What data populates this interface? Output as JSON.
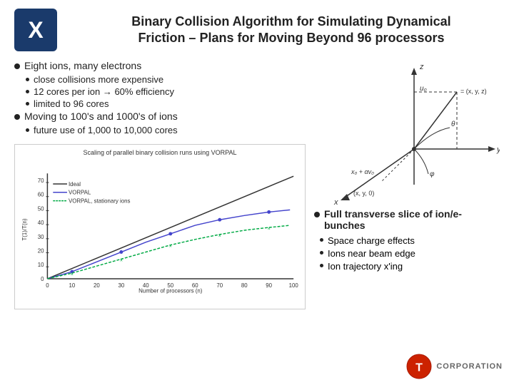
{
  "header": {
    "title_line1": "Binary Collision Algorithm for Simulating Dynamical",
    "title_line2": "Friction – Plans for Moving Beyond 96 processors"
  },
  "left_bullets": {
    "main1": {
      "label": "Eight ions, many electrons",
      "subs": [
        {
          "text": "close collisions more expensive"
        },
        {
          "text": "12 cores per ion → 60% efficiency"
        },
        {
          "text": "limited to 96 cores"
        }
      ]
    },
    "main2": {
      "label": "Moving to 100's and 1000's of ions",
      "subs": [
        {
          "text": "future use of 1,000 to 10,000 cores"
        }
      ]
    }
  },
  "chart": {
    "title": "Scaling of parallel binary collision runs using VORPAL",
    "x_label": "Number of processors (n)",
    "y_label": "T(1)/T(n)",
    "legend": [
      {
        "label": "Ideal",
        "color": "#333"
      },
      {
        "label": "VORPAL",
        "color": "#4444cc"
      },
      {
        "label": "VORPAL, stationary ions",
        "color": "#00aa44"
      }
    ]
  },
  "right_section": {
    "full_transverse": "Full transverse slice of ion/e- bunches",
    "sub_bullets": [
      {
        "text": "Space charge effects"
      },
      {
        "text": "Ions near beam edge"
      },
      {
        "text": "Ion trajectory x'ing"
      }
    ]
  },
  "footer": {
    "corp_label": "CORPORATION"
  }
}
